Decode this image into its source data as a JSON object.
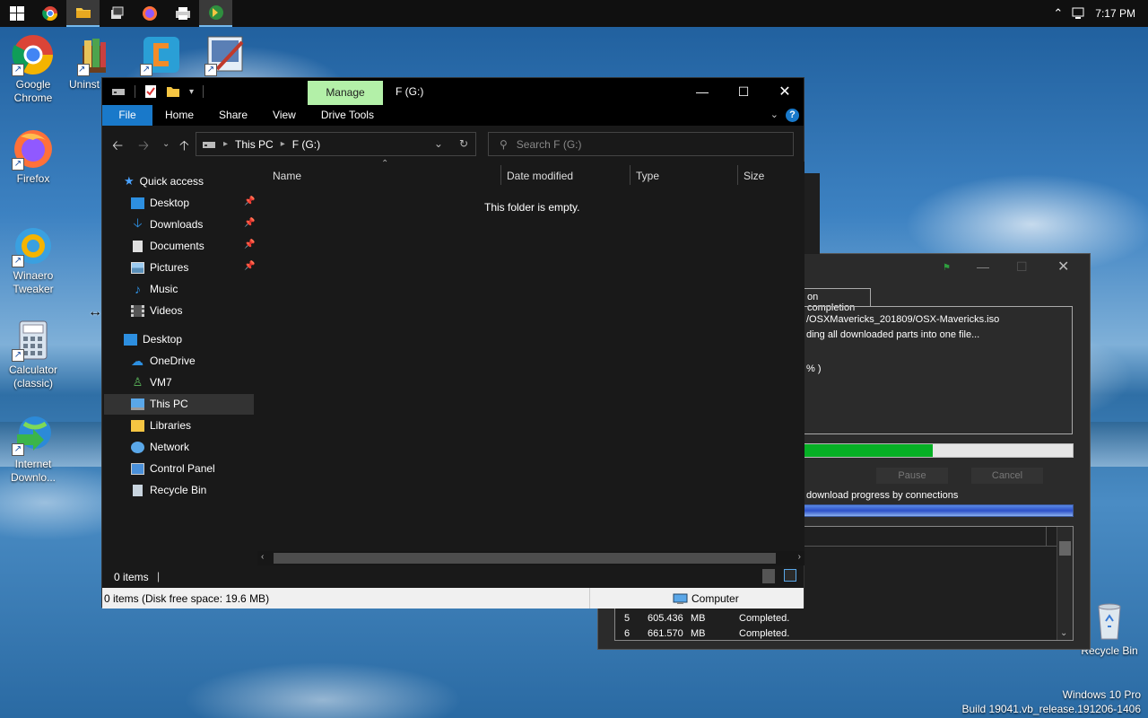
{
  "taskbar": {
    "time": "7:17 PM",
    "apps": [
      "start",
      "chrome",
      "file-explorer",
      "winaero-tweaker",
      "firefox",
      "printer",
      "internet-download-manager"
    ]
  },
  "desktop_icons": [
    {
      "label": "Google\nChrome",
      "line1": "Google",
      "line2": "Chrome"
    },
    {
      "label": "Uninst",
      "line1": "Uninst",
      "line2": ""
    },
    {
      "label": "Firefox",
      "line1": "Firefox",
      "line2": ""
    },
    {
      "label": "Winaero Tweaker",
      "line1": "Winaero",
      "line2": "Tweaker"
    },
    {
      "label": "Calculator (classic)",
      "line1": "Calculator",
      "line2": "(classic)"
    },
    {
      "label": "Internet Downlo...",
      "line1": "Internet",
      "line2": "Downlo..."
    },
    {
      "label": "Recycle Bin",
      "line1": "Recycle Bin",
      "line2": ""
    }
  ],
  "watermark": {
    "line1": "Windows 10 Pro",
    "line2": "Build 19041.vb_release.191206-1406"
  },
  "explorer": {
    "manage_tab": "Manage",
    "title": "F (G:)",
    "ribbon_tabs": [
      "File",
      "Home",
      "Share",
      "View",
      "Drive Tools"
    ],
    "help": "?",
    "breadcrumb": [
      "This PC",
      "F (G:)"
    ],
    "search_placeholder": "Search F (G:)",
    "nav": {
      "quick_access": "Quick access",
      "desktop": "Desktop",
      "downloads": "Downloads",
      "documents": "Documents",
      "pictures": "Pictures",
      "music": "Music",
      "videos": "Videos",
      "desktop_root": "Desktop",
      "onedrive": "OneDrive",
      "vm7": "VM7",
      "this_pc": "This PC",
      "libraries": "Libraries",
      "network": "Network",
      "control_panel": "Control Panel",
      "recycle_bin": "Recycle Bin"
    },
    "columns": [
      "Name",
      "Date modified",
      "Type",
      "Size"
    ],
    "empty_message": "This folder is empty.",
    "item_count": "0 items",
    "statusbar_left": "0 items (Disk free space: 19.6 MB)",
    "statusbar_right": "Computer"
  },
  "idm": {
    "tab": "on completion",
    "path": "/OSXMavericks_201809/OSX-Mavericks.iso",
    "status": "ding all downloaded parts into one file...",
    "percent_fragment": "% )",
    "progress": 0.48,
    "pause_label": "Pause",
    "cancel_label": "Cancel",
    "conn_label": "download progress by connections",
    "rows": [
      {
        "n": "5",
        "size": "605.436",
        "unit": "MB",
        "status": "Completed."
      },
      {
        "n": "6",
        "size": "661.570",
        "unit": "MB",
        "status": "Completed."
      }
    ]
  }
}
